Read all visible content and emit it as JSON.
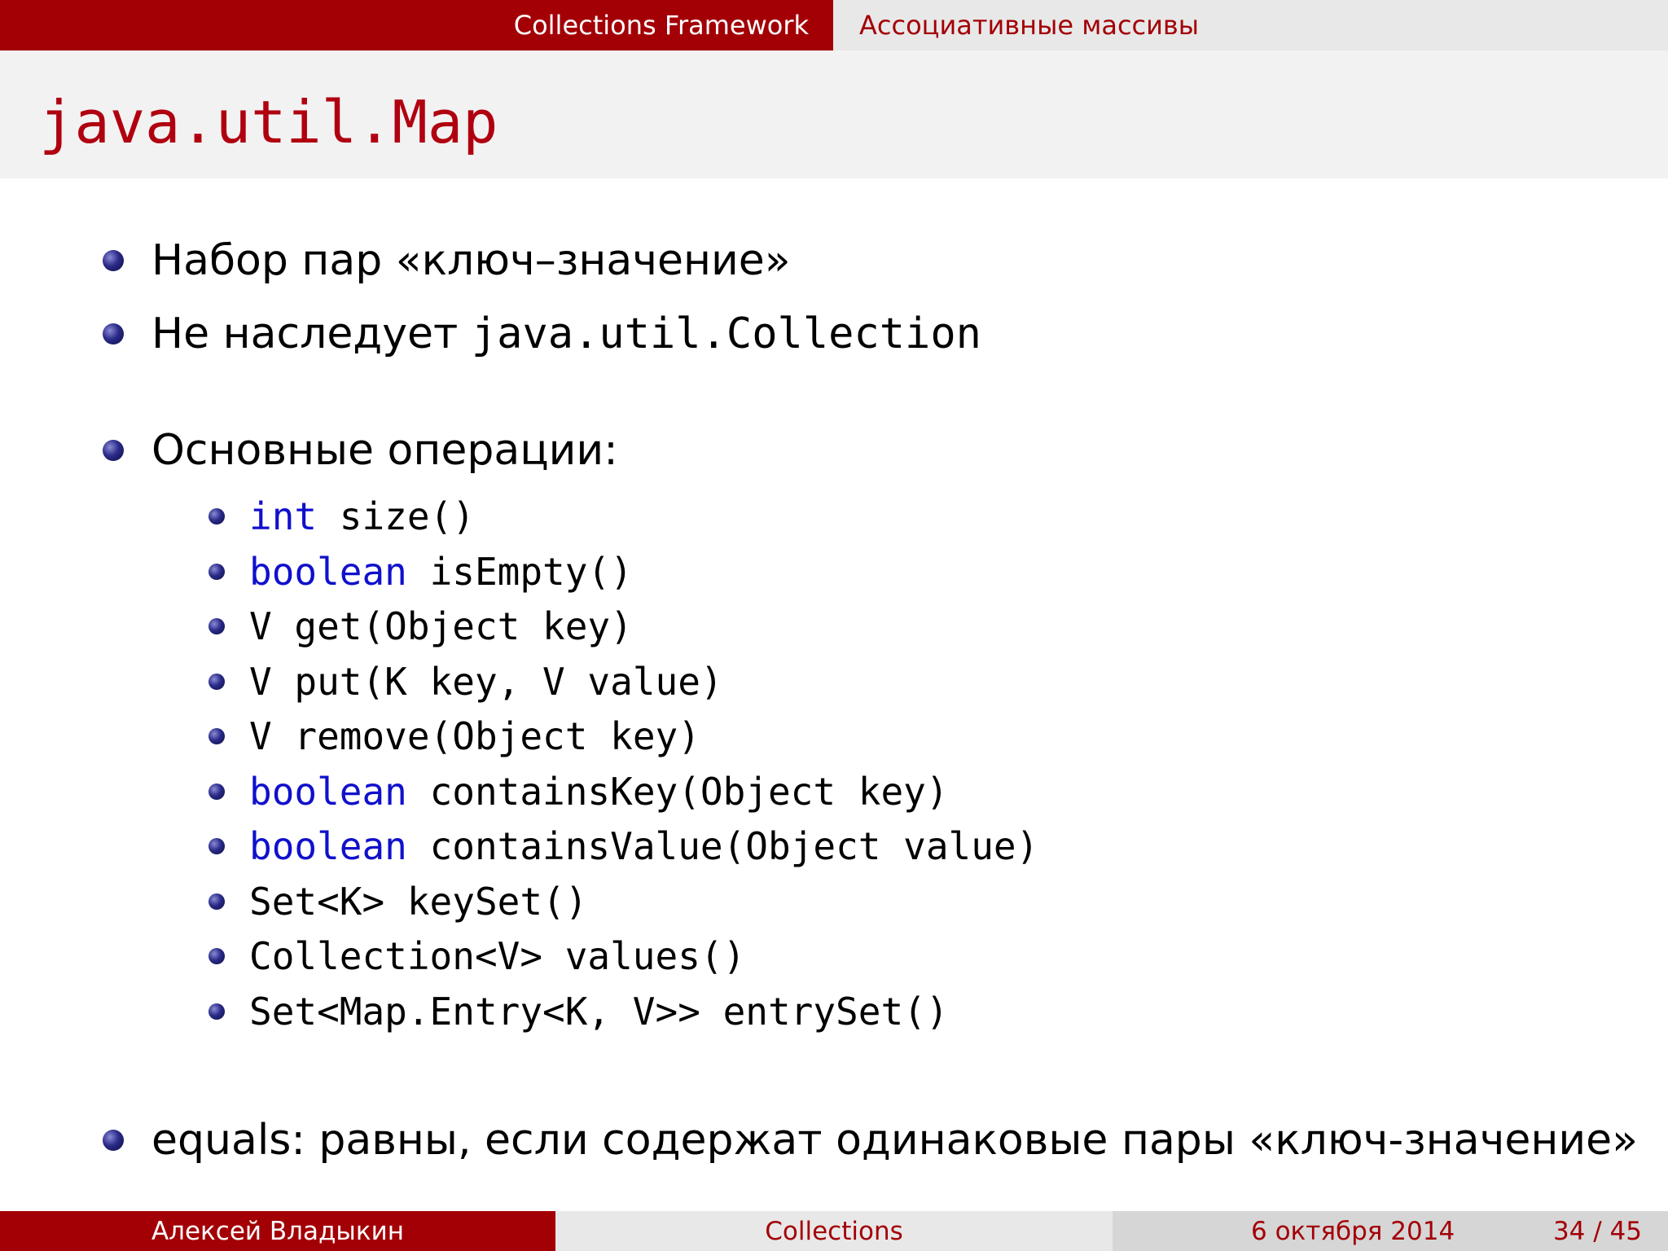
{
  "header": {
    "section": "Collections Framework",
    "subsection": "Ассоциативные массивы"
  },
  "frame_title": "java.util.Map",
  "bullets": [
    {
      "text": "Набор пар «ключ–значение»"
    },
    {
      "text": "Не наследует ",
      "code": "java.util.Collection"
    },
    {
      "text": "Основные операции:"
    },
    {
      "text": "equals: равны, если содержат одинаковые пары «ключ-значение»"
    }
  ],
  "operations": [
    {
      "type": "int",
      "rest": " size()",
      "type_is_keyword": true
    },
    {
      "type": "boolean",
      "rest": " isEmpty()",
      "type_is_keyword": true
    },
    {
      "type": "V",
      "rest": " get(Object key)",
      "type_is_keyword": false
    },
    {
      "type": "V",
      "rest": " put(K key, V value)",
      "type_is_keyword": false
    },
    {
      "type": "V",
      "rest": " remove(Object key)",
      "type_is_keyword": false
    },
    {
      "type": "boolean",
      "rest": " containsKey(Object key)",
      "type_is_keyword": true
    },
    {
      "type": "boolean",
      "rest": " containsValue(Object value)",
      "type_is_keyword": true
    },
    {
      "type": "Set<K>",
      "rest": " keySet()",
      "type_is_keyword": false
    },
    {
      "type": "Collection<V>",
      "rest": " values()",
      "type_is_keyword": false
    },
    {
      "type": "Set<Map.Entry<K, V>>",
      "rest": " entrySet()",
      "type_is_keyword": false
    }
  ],
  "footer": {
    "author": "Алексей Владыкин",
    "title": "Collections",
    "date": "6 октября 2014",
    "page": "34 / 45"
  },
  "colors": {
    "theme_red": "#a30006",
    "keyword_blue": "#1010cc"
  }
}
